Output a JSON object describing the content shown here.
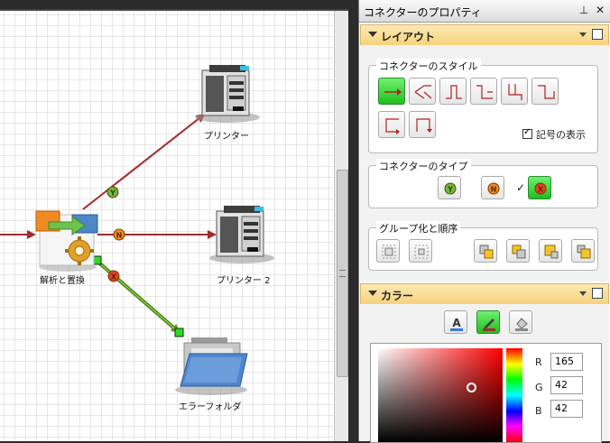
{
  "canvas": {
    "nodes": {
      "parse": {
        "label": "解析と置換"
      },
      "printer1": {
        "label": "プリンター"
      },
      "printer2": {
        "label": "プリンター 2"
      },
      "error_folder": {
        "label": "エラーフォルダ"
      }
    },
    "connectors": [
      {
        "letter": "Y",
        "color": "#a52a2a",
        "badge": "#5cc13a"
      },
      {
        "letter": "N",
        "color": "#a52a2a",
        "badge": "#f08a1a"
      },
      {
        "letter": "X",
        "color": "#6fa21e",
        "badge": "#e0402a"
      }
    ]
  },
  "panel": {
    "title": "コネクターのプロパティ",
    "pin_icon": "pin-icon",
    "close_icon": "close-icon",
    "layout_section": {
      "title": "レイアウト",
      "style_group": {
        "title": "コネクターのスタイル",
        "show_symbols_label": "記号の表示",
        "show_symbols_checked": true
      },
      "type_group": {
        "title": "コネクターのタイプ",
        "options": [
          "Y",
          "N",
          "X"
        ]
      },
      "grouping_group": {
        "title": "グループ化と順序"
      }
    },
    "color_section": {
      "title": "カラー",
      "r_label": "R",
      "r_value": "165",
      "g_label": "G",
      "g_value": "42",
      "b_label": "B",
      "b_value": "42",
      "current_color": "#a52a2a"
    }
  }
}
